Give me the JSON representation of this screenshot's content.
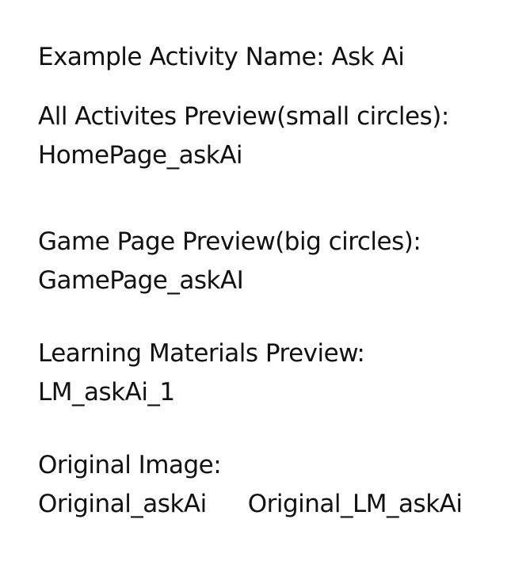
{
  "activity": {
    "label": "Example Activity Name: Ask Ai"
  },
  "all_activities": {
    "heading": "All Activites Preview(small circles):",
    "file": "HomePage_askAi"
  },
  "game_page": {
    "heading": "Game Page Preview(big circles):",
    "file": "GamePage_askAI"
  },
  "learning_materials": {
    "heading": "Learning Materials Preview:",
    "file": "LM_askAi_1"
  },
  "original_image": {
    "heading": "Original Image:",
    "file_1": "Original_askAi",
    "file_2": "Original_LM_askAi"
  }
}
